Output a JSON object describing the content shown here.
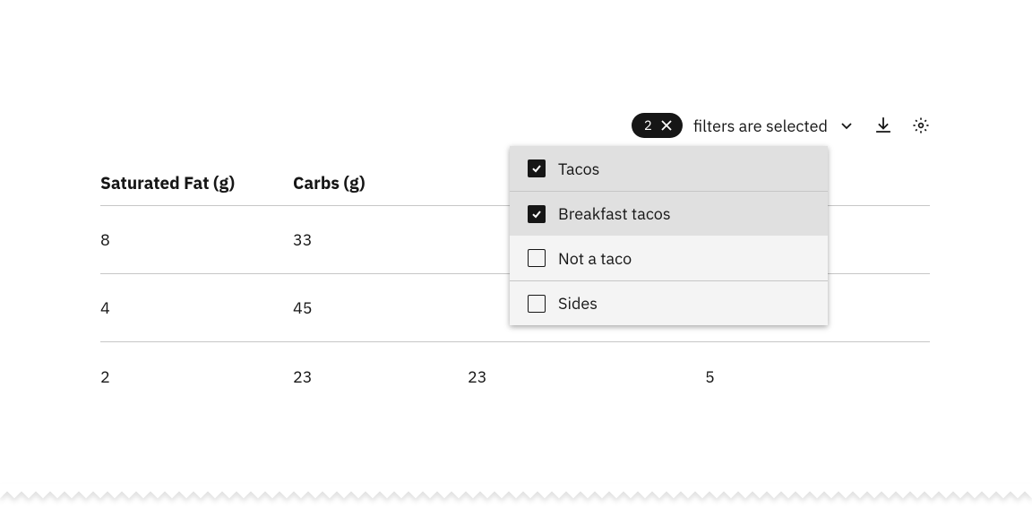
{
  "toolbar": {
    "filter_count": "2",
    "filter_summary": "filters are selected"
  },
  "table": {
    "columns": [
      "Saturated Fat (g)",
      "Carbs (g)",
      "",
      ""
    ],
    "rows": [
      [
        "8",
        "33",
        "",
        ""
      ],
      [
        "4",
        "45",
        "",
        ""
      ],
      [
        "2",
        "23",
        "23",
        "5"
      ]
    ]
  },
  "filter_panel": {
    "options": [
      {
        "label": "Tacos",
        "checked": true
      },
      {
        "label": "Breakfast tacos",
        "checked": true
      },
      {
        "label": "Not a taco",
        "checked": false
      },
      {
        "label": "Sides",
        "checked": false
      }
    ]
  }
}
